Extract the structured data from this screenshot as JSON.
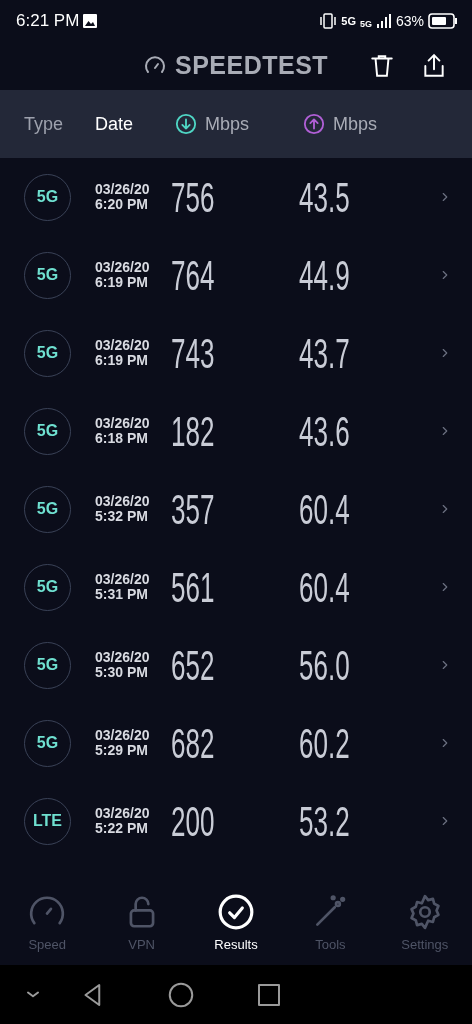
{
  "status_bar": {
    "time": "6:21 PM",
    "network_1": "5G",
    "network_2": "5G",
    "battery": "63%"
  },
  "header": {
    "title": "SPEEDTEST"
  },
  "columns": [
    {
      "label": "Type",
      "kind": "text"
    },
    {
      "label": "Date",
      "kind": "text"
    },
    {
      "label": "Mbps",
      "kind": "download"
    },
    {
      "label": "Mbps",
      "kind": "upload"
    }
  ],
  "results": [
    {
      "type": "5G",
      "date": "03/26/20",
      "time": "6:20 PM",
      "download": "756",
      "upload": "43.5"
    },
    {
      "type": "5G",
      "date": "03/26/20",
      "time": "6:19 PM",
      "download": "764",
      "upload": "44.9"
    },
    {
      "type": "5G",
      "date": "03/26/20",
      "time": "6:19 PM",
      "download": "743",
      "upload": "43.7"
    },
    {
      "type": "5G",
      "date": "03/26/20",
      "time": "6:18 PM",
      "download": "182",
      "upload": "43.6"
    },
    {
      "type": "5G",
      "date": "03/26/20",
      "time": "5:32 PM",
      "download": "357",
      "upload": "60.4"
    },
    {
      "type": "5G",
      "date": "03/26/20",
      "time": "5:31 PM",
      "download": "561",
      "upload": "60.4"
    },
    {
      "type": "5G",
      "date": "03/26/20",
      "time": "5:30 PM",
      "download": "652",
      "upload": "56.0"
    },
    {
      "type": "5G",
      "date": "03/26/20",
      "time": "5:29 PM",
      "download": "682",
      "upload": "60.2"
    },
    {
      "type": "LTE",
      "date": "03/26/20",
      "time": "5:22 PM",
      "download": "200",
      "upload": "53.2"
    }
  ],
  "tabs": [
    {
      "label": "Speed",
      "kind": "speed",
      "selected": false
    },
    {
      "label": "VPN",
      "kind": "vpn",
      "selected": false
    },
    {
      "label": "Results",
      "kind": "results",
      "selected": true
    },
    {
      "label": "Tools",
      "kind": "tools",
      "selected": false
    },
    {
      "label": "Settings",
      "kind": "settings",
      "selected": false
    }
  ]
}
